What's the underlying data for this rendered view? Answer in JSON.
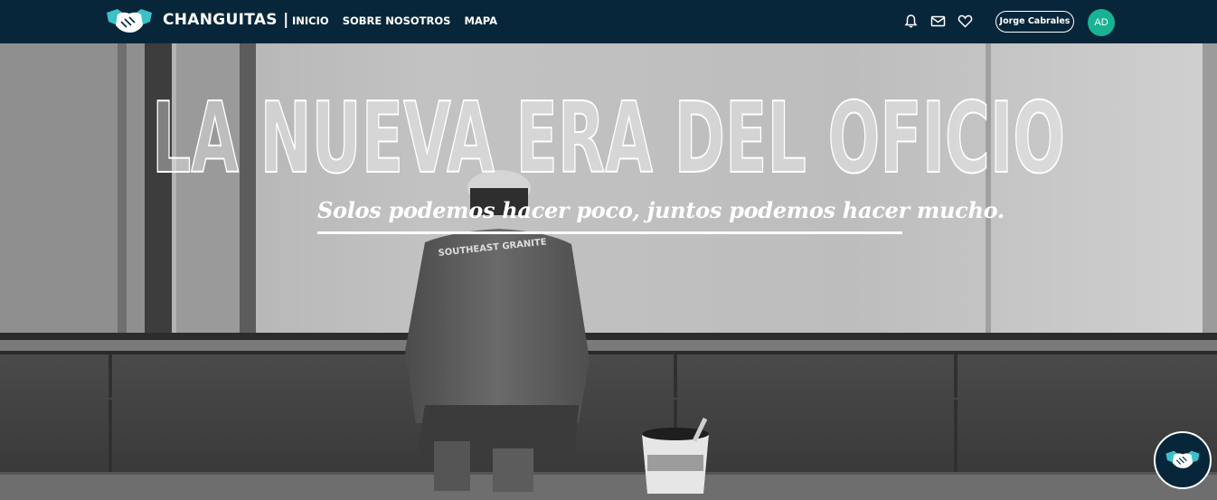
{
  "header": {
    "brand": "CHANGUITAS |",
    "nav": [
      {
        "label": "INICIO"
      },
      {
        "label": "SOBRE NOSOTROS"
      },
      {
        "label": "MAPA"
      }
    ],
    "icons": [
      "bell-icon",
      "mail-icon",
      "heart-icon"
    ],
    "user_button": "Jorge Cabrales",
    "avatar_initials": "AD"
  },
  "hero": {
    "headline": "LA NUEVA ERA DEL OFICIO",
    "tagline": "Solos podemos hacer poco, juntos podemos hacer mucho."
  },
  "colors": {
    "navbar": "#08263a",
    "avatar": "#18b394",
    "accent": "#3cc1c9"
  }
}
